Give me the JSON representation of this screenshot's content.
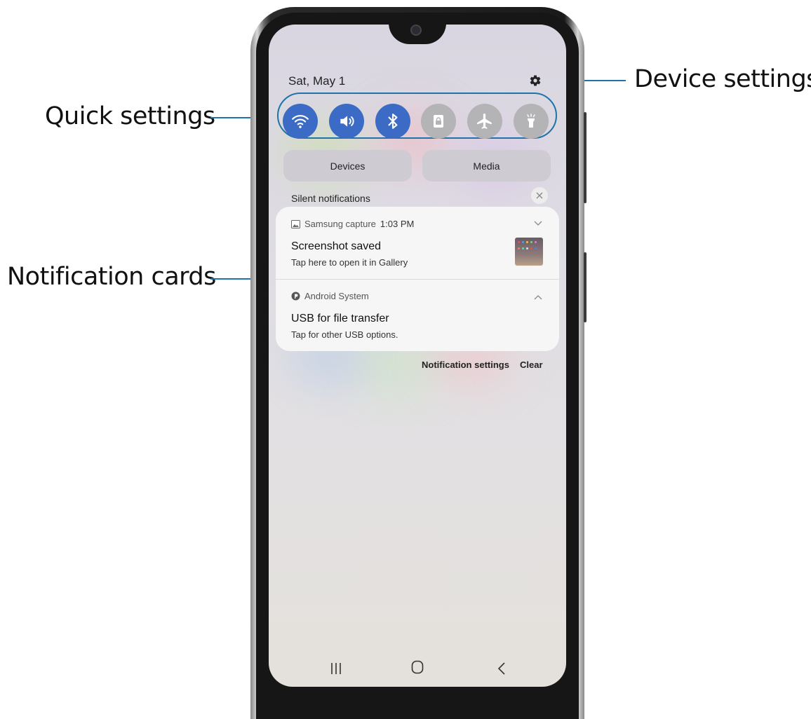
{
  "callouts": {
    "quick_settings": "Quick settings",
    "device_settings": "Device settings",
    "notification_cards": "Notification cards"
  },
  "status": {
    "date": "Sat, May 1"
  },
  "quick_settings": [
    {
      "name": "wifi-icon",
      "state": "on"
    },
    {
      "name": "sound-icon",
      "state": "on"
    },
    {
      "name": "bluetooth-icon",
      "state": "on"
    },
    {
      "name": "screen-lock-icon",
      "state": "off"
    },
    {
      "name": "airplane-icon",
      "state": "off"
    },
    {
      "name": "flashlight-icon",
      "state": "off"
    }
  ],
  "panel": {
    "devices_label": "Devices",
    "media_label": "Media",
    "silent_label": "Silent notifications"
  },
  "notifications": [
    {
      "app": "Samsung capture",
      "time": "1:03 PM",
      "title": "Screenshot saved",
      "subtitle": "Tap here to open it in Gallery"
    },
    {
      "app": "Android System",
      "time": "",
      "title": "USB for file transfer",
      "subtitle": "Tap for other USB options."
    }
  ],
  "footer": {
    "settings_label": "Notification settings",
    "clear_label": "Clear"
  },
  "colors": {
    "accent": "#1f73a8",
    "toggle_on": "#3b6bc4",
    "toggle_off": "#b4b3b6"
  }
}
